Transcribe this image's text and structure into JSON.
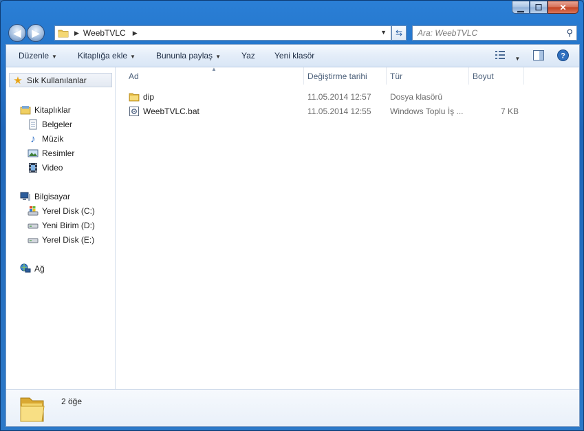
{
  "window": {
    "caption_buttons": {
      "minimize": "▁",
      "maximize": "☐",
      "close": "✕"
    }
  },
  "nav": {
    "back_glyph": "◀",
    "forward_glyph": "▶",
    "breadcrumb": [
      "WeebTVLC"
    ],
    "search_placeholder": "Ara: WeebTVLC",
    "icons": {
      "back": "back-arrow-icon",
      "forward": "forward-arrow-icon",
      "refresh": "refresh-icon",
      "search": "search-icon"
    }
  },
  "toolbar": {
    "organize": "Düzenle",
    "include_in_library": "Kitaplığa ekle",
    "share_with": "Bununla paylaş",
    "print": "Yaz",
    "new_folder": "Yeni klasör"
  },
  "sidebar": {
    "favorites": "Sık Kullanılanlar",
    "libraries": "Kitaplıklar",
    "library_items": [
      "Belgeler",
      "Müzik",
      "Resimler",
      "Video"
    ],
    "computer": "Bilgisayar",
    "drives": [
      "Yerel Disk (C:)",
      "Yeni Birim (D:)",
      "Yerel Disk (E:)"
    ],
    "network": "Ağ"
  },
  "columns": {
    "name": "Ad",
    "date_modified": "Değiştirme tarihi",
    "type": "Tür",
    "size": "Boyut"
  },
  "files": [
    {
      "name": "dip",
      "date": "11.05.2014 12:57",
      "type": "Dosya klasörü",
      "size": "",
      "icon": "folder-icon"
    },
    {
      "name": "WeebTVLC.bat",
      "date": "11.05.2014 12:55",
      "type": "Windows Toplu İş ...",
      "size": "7 KB",
      "icon": "batch-file-icon"
    }
  ],
  "details": {
    "item_count": "2 öğe"
  },
  "colors": {
    "accent": "#2a7fd6",
    "toolbar_text": "#1e2d45",
    "header_text": "#4c607a"
  }
}
